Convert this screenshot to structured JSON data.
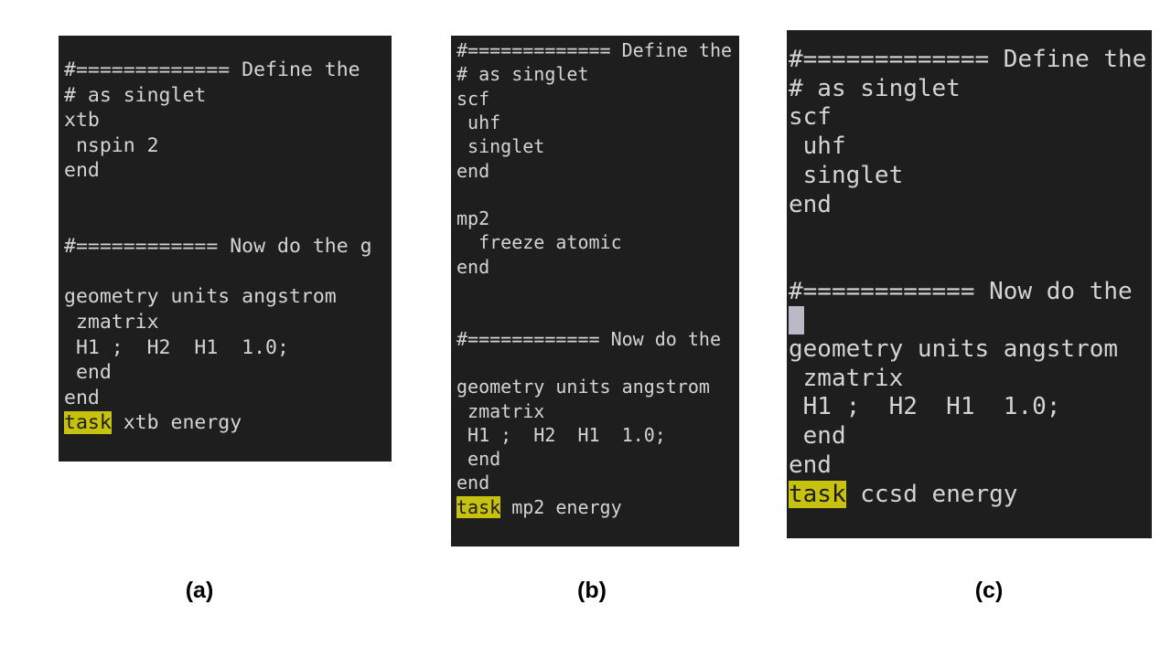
{
  "panels": [
    {
      "id": "a",
      "caption": "(a)",
      "lines": [
        {
          "text": "#============= Define the"
        },
        {
          "text": "# as singlet"
        },
        {
          "text": "xtb"
        },
        {
          "text": " nspin 2"
        },
        {
          "text": "end"
        },
        {
          "text": ""
        },
        {
          "text": ""
        },
        {
          "text": "#============ Now do the g"
        },
        {
          "text": ""
        },
        {
          "text": "geometry units angstrom"
        },
        {
          "text": " zmatrix"
        },
        {
          "text": " H1 ;  H2  H1  1.0;"
        },
        {
          "text": " end"
        },
        {
          "text": "end"
        },
        {
          "highlight": "task",
          "text": " xtb energy"
        }
      ]
    },
    {
      "id": "b",
      "caption": "(b)",
      "lines": [
        {
          "text": "#============= Define the"
        },
        {
          "text": "# as singlet"
        },
        {
          "text": "scf"
        },
        {
          "text": " uhf"
        },
        {
          "text": " singlet"
        },
        {
          "text": "end"
        },
        {
          "text": ""
        },
        {
          "text": "mp2"
        },
        {
          "text": "  freeze atomic"
        },
        {
          "text": "end"
        },
        {
          "text": ""
        },
        {
          "text": ""
        },
        {
          "text": "#============ Now do the"
        },
        {
          "text": ""
        },
        {
          "text": "geometry units angstrom"
        },
        {
          "text": " zmatrix"
        },
        {
          "text": " H1 ;  H2  H1  1.0;"
        },
        {
          "text": " end"
        },
        {
          "text": "end"
        },
        {
          "highlight": "task",
          "text": " mp2 energy"
        }
      ]
    },
    {
      "id": "c",
      "caption": "(c)",
      "lines": [
        {
          "text": "#============= Define the"
        },
        {
          "text": "# as singlet"
        },
        {
          "text": "scf"
        },
        {
          "text": " uhf"
        },
        {
          "text": " singlet"
        },
        {
          "text": "end"
        },
        {
          "text": ""
        },
        {
          "text": ""
        },
        {
          "text": "#============ Now do the"
        },
        {
          "cursor": true,
          "text": ""
        },
        {
          "text": "geometry units angstrom"
        },
        {
          "text": " zmatrix"
        },
        {
          "text": " H1 ;  H2  H1  1.0;"
        },
        {
          "text": " end"
        },
        {
          "text": "end"
        },
        {
          "highlight": "task",
          "text": " ccsd energy"
        }
      ]
    }
  ],
  "colors": {
    "editor_background": "#1e1e1e",
    "text": "#d4d4d4",
    "keyword_highlight": "#c7c10f",
    "cursor": "#b9b9c8"
  }
}
